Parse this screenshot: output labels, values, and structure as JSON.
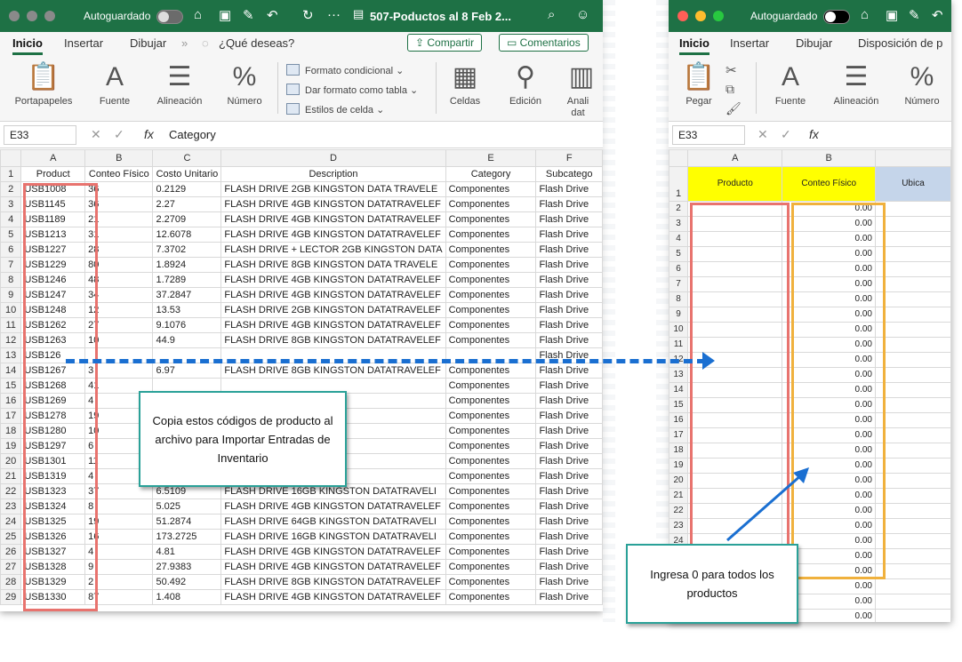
{
  "left_window": {
    "autosave_label": "Autoguardado",
    "title": "507-Poductos al 8 Feb 2...",
    "tabs": [
      "Inicio",
      "Insertar",
      "Dibujar"
    ],
    "tell_me": "¿Qué deseas?",
    "share_label": "Compartir",
    "comments_label": "Comentarios",
    "ribbon": {
      "portapapeles": "Portapapeles",
      "fuente": "Fuente",
      "alineacion": "Alineación",
      "numero": "Número",
      "formato_condicional": "Formato condicional",
      "dar_formato_tabla": "Dar formato como tabla",
      "estilos_celda": "Estilos de celda",
      "celdas": "Celdas",
      "edicion": "Edición",
      "analizar": "Anali dat"
    },
    "name_box": "E33",
    "formula": "Category",
    "column_letters": [
      "A",
      "B",
      "C",
      "D",
      "E",
      "F"
    ],
    "headers": [
      "Product",
      "Conteo Físico",
      "Costo Unitario",
      "Description",
      "Category",
      "Subcatego"
    ],
    "rows": [
      [
        "USB1008",
        "36",
        "0.2129",
        "FLASH DRIVE 2GB KINGSTON DATA TRAVELE",
        "Componentes",
        "Flash Drive"
      ],
      [
        "USB1145",
        "36",
        "2.27",
        "FLASH DRIVE 4GB KINGSTON DATATRAVELEF",
        "Componentes",
        "Flash Drive"
      ],
      [
        "USB1189",
        "21",
        "2.2709",
        "FLASH DRIVE 4GB KINGSTON DATATRAVELEF",
        "Componentes",
        "Flash Drive"
      ],
      [
        "USB1213",
        "31",
        "12.6078",
        "FLASH DRIVE 4GB KINGSTON DATATRAVELEF",
        "Componentes",
        "Flash Drive"
      ],
      [
        "USB1227",
        "28",
        "7.3702",
        "FLASH DRIVE + LECTOR 2GB KINGSTON DATA",
        "Componentes",
        "Flash Drive"
      ],
      [
        "USB1229",
        "80",
        "1.8924",
        "FLASH DRIVE 8GB KINGSTON DATA TRAVELE",
        "Componentes",
        "Flash Drive"
      ],
      [
        "USB1246",
        "48",
        "1.7289",
        "FLASH DRIVE 4GB KINGSTON DATATRAVELEF",
        "Componentes",
        "Flash Drive"
      ],
      [
        "USB1247",
        "34",
        "37.2847",
        "FLASH DRIVE 4GB KINGSTON DATATRAVELEF",
        "Componentes",
        "Flash Drive"
      ],
      [
        "USB1248",
        "12",
        "13.53",
        "FLASH DRIVE 2GB KINGSTON DATATRAVELEF",
        "Componentes",
        "Flash Drive"
      ],
      [
        "USB1262",
        "27",
        "9.1076",
        "FLASH DRIVE 4GB KINGSTON DATATRAVELEF",
        "Componentes",
        "Flash Drive"
      ],
      [
        "USB1263",
        "10",
        "44.9",
        "FLASH DRIVE 8GB KINGSTON DATATRAVELEF",
        "Componentes",
        "Flash Drive"
      ],
      [
        "USB126",
        "",
        "",
        "",
        "",
        "Flash Drive"
      ],
      [
        "USB1267",
        "3",
        "6.97",
        "FLASH DRIVE 8GB KINGSTON DATATRAVELEF",
        "Componentes",
        "Flash Drive"
      ],
      [
        "USB1268",
        "41",
        "",
        "",
        "Componentes",
        "Flash Drive"
      ],
      [
        "USB1269",
        "4",
        "",
        "ON DATATRAV MIN",
        "Componentes",
        "Flash Drive"
      ],
      [
        "USB1278",
        "19",
        "",
        "ON DATATRAVELEF",
        "Componentes",
        "Flash Drive"
      ],
      [
        "USB1280",
        "10",
        "",
        "LEXAR 4GB M2#LN",
        "Componentes",
        "Flash Drive"
      ],
      [
        "USB1297",
        "6",
        "",
        "GTON DATA TRAVELL",
        "Componentes",
        "Flash Drive"
      ],
      [
        "USB1301",
        "11",
        "",
        "GTON DATA TRAVELE",
        "Componentes",
        "Flash Drive"
      ],
      [
        "USB1319",
        "4",
        "",
        "GTON DATATRAVELEF",
        "Componentes",
        "Flash Drive"
      ],
      [
        "USB1323",
        "37",
        "6.5109",
        "FLASH DRIVE 16GB KINGSTON DATATRAVELI",
        "Componentes",
        "Flash Drive"
      ],
      [
        "USB1324",
        "8",
        "5.025",
        "FLASH DRIVE 4GB KINGSTON DATATRAVELEF",
        "Componentes",
        "Flash Drive"
      ],
      [
        "USB1325",
        "19",
        "51.2874",
        "FLASH DRIVE 64GB KINGSTON DATATRAVELI",
        "Componentes",
        "Flash Drive"
      ],
      [
        "USB1326",
        "16",
        "173.2725",
        "FLASH DRIVE 16GB KINGSTON DATATRAVELI",
        "Componentes",
        "Flash Drive"
      ],
      [
        "USB1327",
        "4",
        "4.81",
        "FLASH DRIVE 4GB KINGSTON DATATRAVELEF",
        "Componentes",
        "Flash Drive"
      ],
      [
        "USB1328",
        "9",
        "27.9383",
        "FLASH DRIVE 4GB KINGSTON DATATRAVELEF",
        "Componentes",
        "Flash Drive"
      ],
      [
        "USB1329",
        "2",
        "50.492",
        "FLASH DRIVE 8GB KINGSTON DATATRAVELEF",
        "Componentes",
        "Flash Drive"
      ],
      [
        "USB1330",
        "87",
        "1.408",
        "FLASH DRIVE 4GB KINGSTON DATATRAVELEF",
        "Componentes",
        "Flash Drive"
      ]
    ]
  },
  "right_window": {
    "autosave_label": "Autoguardado",
    "tabs": [
      "Inicio",
      "Insertar",
      "Dibujar",
      "Disposición de p"
    ],
    "ribbon": {
      "pegar": "Pegar",
      "fuente": "Fuente",
      "alineacion": "Alineación",
      "numero": "Número"
    },
    "name_box": "E33",
    "column_letters": [
      "A",
      "B"
    ],
    "headers": [
      "Producto",
      "Conteo Físico",
      "Ubica"
    ],
    "zero_value": "0.00",
    "row_count": 29
  },
  "callouts": {
    "copy_note": "Copia estos códigos de producto al archivo para Importar Entradas de Inventario",
    "zero_note": "Ingresa 0 para todos los productos"
  },
  "colors": {
    "excel_green": "#1e7145",
    "header_yellow": "#ffff00",
    "header_blue": "#c5d5ea",
    "red_highlight": "#e8736e",
    "orange_highlight": "#f0b13d",
    "arrow_blue": "#1a6fd1",
    "callout_border": "#2aa198"
  }
}
